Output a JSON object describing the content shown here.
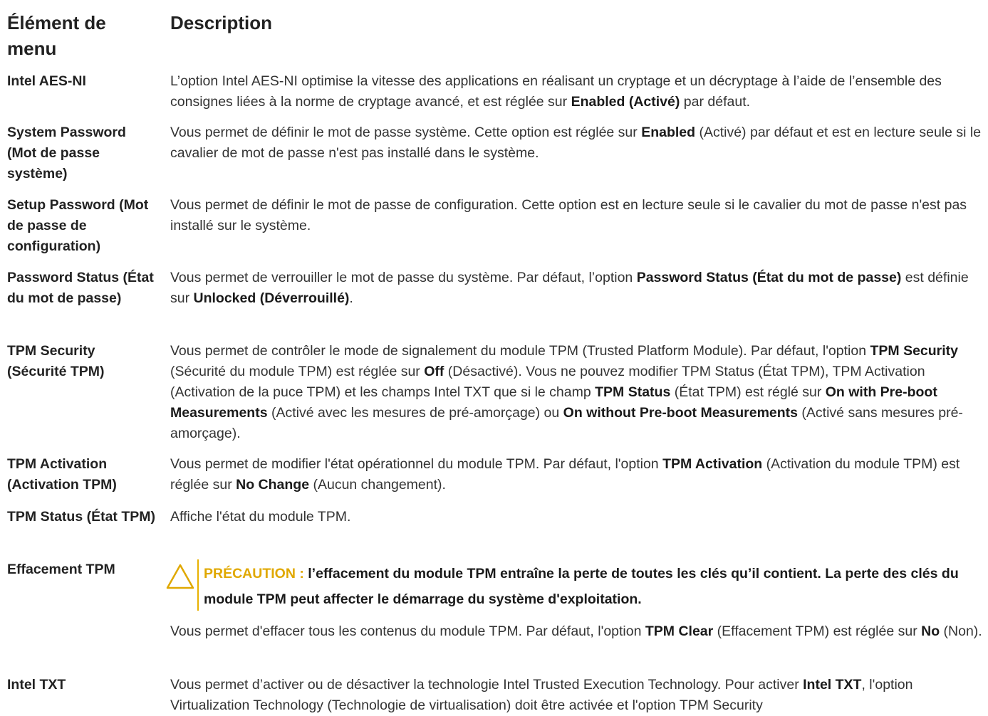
{
  "header": {
    "menu_item": "Élément de menu",
    "description": "Description"
  },
  "rows": {
    "aes": {
      "term": "Intel AES-NI",
      "d1": "L’option Intel AES-NI optimise la vitesse des applications en réalisant un cryptage et un décryptage à l’aide de l’ensemble des consignes liées à la norme de cryptage avancé, et est réglée sur ",
      "d2": "Enabled (Activé)",
      "d3": " par défaut."
    },
    "syspwd": {
      "term": "System Password (Mot de passe système)",
      "d1": "Vous permet de définir le mot de passe système. Cette option est réglée sur ",
      "d2": "Enabled",
      "d3": " (Activé) par défaut et est en lecture seule si le cavalier de mot de passe n'est pas installé dans le système."
    },
    "setuppwd": {
      "term": "Setup Password (Mot de passe de configuration)",
      "d1": "Vous permet de définir le mot de passe de configuration. Cette option est en lecture seule si le cavalier du mot de passe n'est pas installé sur le système."
    },
    "pwdstatus": {
      "term": "Password Status (État du mot de passe)",
      "d1": "Vous permet de verrouiller le mot de passe du système. Par défaut, l’option ",
      "d2": "Password Status (État du mot de passe)",
      "d3": " est définie sur ",
      "d4": "Unlocked (Déverrouillé)",
      "d5": "."
    },
    "tpmsec": {
      "term": "TPM Security (Sécurité TPM)",
      "d1": "Vous permet de contrôler le mode de signalement du module TPM (Trusted Platform Module). Par défaut, l'option ",
      "d2": "TPM Security",
      "d3": " (Sécurité du module TPM) est réglée sur ",
      "d4": "Off",
      "d5": " (Désactivé). Vous ne pouvez modifier TPM Status (État TPM), TPM Activation (Activation de la puce TPM) et les champs Intel TXT que si le champ ",
      "d6": "TPM Status",
      "d7": " (État TPM) est réglé sur ",
      "d8": "On with Pre-boot Measurements",
      "d9": " (Activé avec les mesures de pré-amorçage) ou ",
      "d10": "On without Pre-boot Measurements",
      "d11": " (Activé sans mesures pré-amorçage)."
    },
    "tpmact": {
      "term": "TPM Activation (Activation TPM)",
      "d1": "Vous permet de modifier l'état opérationnel du module TPM. Par défaut, l'option ",
      "d2": "TPM Activation",
      "d3": " (Activation du module TPM) est réglée sur ",
      "d4": "No Change",
      "d5": " (Aucun changement)."
    },
    "tpmstatus": {
      "term": "TPM Status (État TPM)",
      "d1": "Affiche l'état du module TPM."
    },
    "tpmclear": {
      "term": "Effacement TPM",
      "caution_label": "PRÉCAUTION :",
      "caution_text": " l’effacement du module TPM entraîne la perte de toutes les clés qu’il contient. La perte des clés du module TPM peut affecter le démarrage du système d'exploitation.",
      "d1": "Vous permet d'effacer tous les contenus du module TPM. Par défaut, l'option ",
      "d2": "TPM Clear",
      "d3": " (Effacement TPM) est réglée sur ",
      "d4": "No",
      "d5": " (Non)."
    },
    "txt": {
      "term": "Intel TXT",
      "d1": "Vous permet d’activer ou de désactiver la technologie Intel Trusted Execution Technology. Pour activer ",
      "d2": "Intel TXT",
      "d3": ", l'option Virtualization Technology (Technologie de virtualisation) doit être activée et l'option TPM Security"
    }
  },
  "colors": {
    "caution": "#e0a800"
  },
  "icons": {
    "caution": "warning-triangle-icon"
  }
}
